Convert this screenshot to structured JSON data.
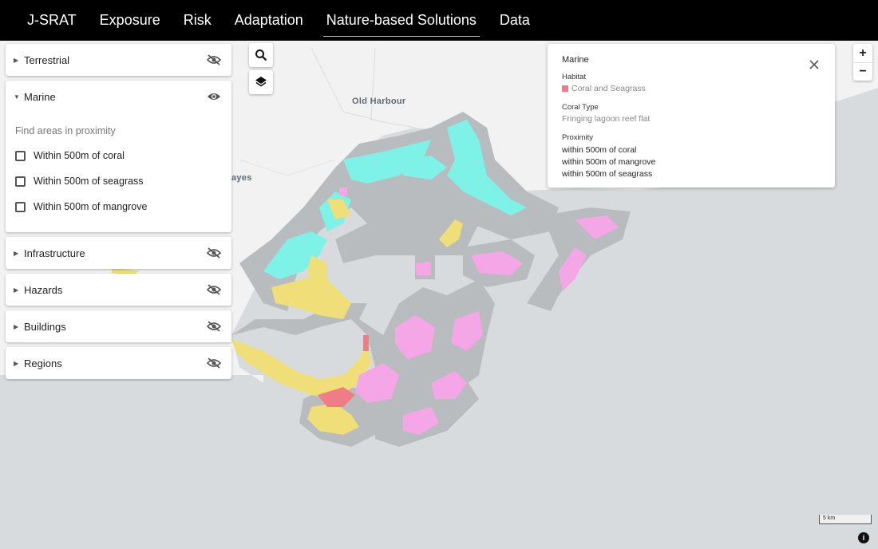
{
  "nav": {
    "brand": "J-SRAT",
    "items": [
      "Exposure",
      "Risk",
      "Adaptation",
      "Nature-based Solutions",
      "Data"
    ],
    "active": "Nature-based Solutions",
    "active_color": "#e9c46a"
  },
  "map": {
    "place_labels": [
      "Old Harbour",
      "ayes"
    ],
    "scale_label": "5 km",
    "attribution_icon": "info-icon",
    "colors": {
      "coral_seagrass": "#f07d86",
      "coral": "#f5a6e6",
      "seagrass": "#f0df78",
      "mangrove": "#7ef2e6",
      "buffer": "#b9bcbf",
      "sea": "#d7dbdd",
      "land": "#f2f2f2"
    }
  },
  "panels": {
    "terrestrial": {
      "label": "Terrestrial",
      "expanded": false,
      "visible": false
    },
    "marine": {
      "label": "Marine",
      "expanded": true,
      "visible": true,
      "subheading": "Find areas in proximity",
      "options": [
        "Within 500m of coral",
        "Within 500m of seagrass",
        "Within 500m of mangrove"
      ]
    },
    "infrastructure": {
      "label": "Infrastructure",
      "expanded": false,
      "visible": false
    },
    "hazards": {
      "label": "Hazards",
      "expanded": false,
      "visible": false
    },
    "buildings": {
      "label": "Buildings",
      "expanded": false,
      "visible": false
    },
    "regions": {
      "label": "Regions",
      "expanded": false,
      "visible": false
    }
  },
  "controls": {
    "search_icon": "search-icon",
    "layers_icon": "layers-icon",
    "zoom_in": "+",
    "zoom_out": "−"
  },
  "popup": {
    "title": "Marine",
    "habitat_label": "Habitat",
    "habitat_value": "Coral and Seagrass",
    "habitat_color": "#f07d86",
    "coral_type_label": "Coral Type",
    "coral_type_value": "Fringing lagoon reef flat",
    "proximity_label": "Proximity",
    "proximity": [
      "within 500m of coral",
      "within 500m of mangrove",
      "within 500m of seagrass"
    ]
  }
}
